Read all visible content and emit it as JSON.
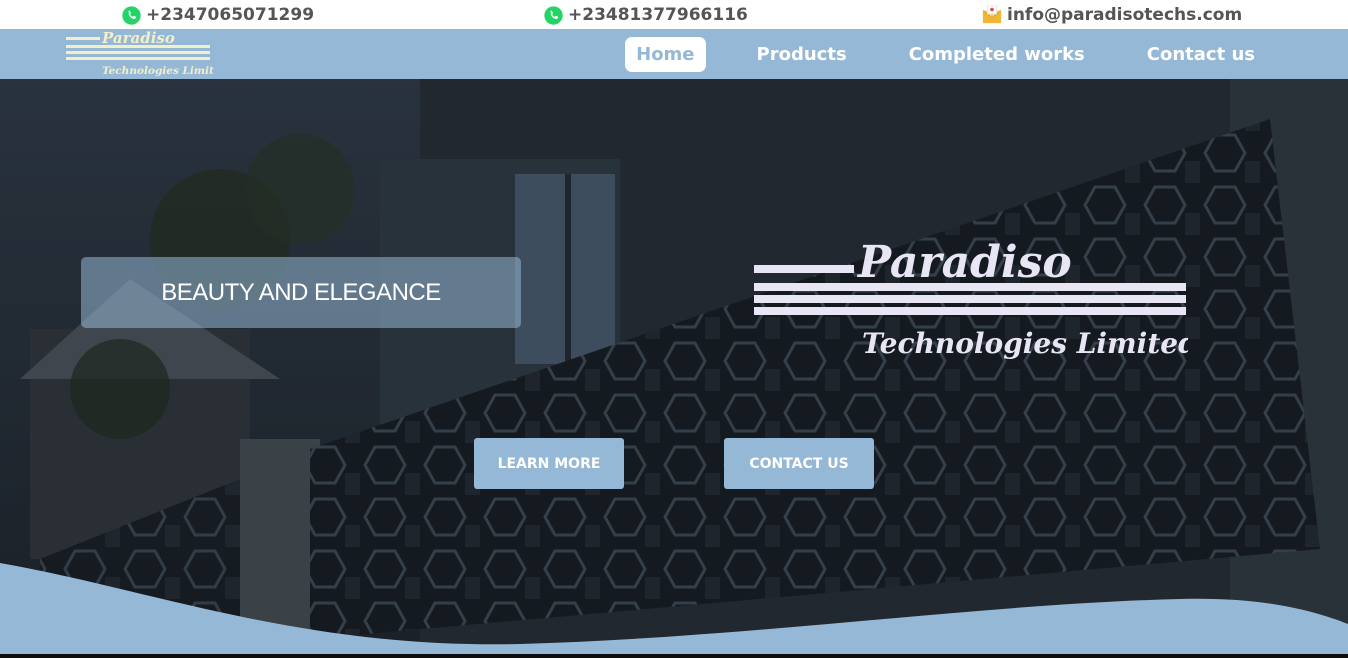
{
  "topbar": {
    "phone1": "+2347065071299",
    "phone2": "+23481377966116",
    "email": "info@paradisotechs.com",
    "icons": [
      "whatsapp-icon",
      "whatsapp-icon",
      "mail-icon"
    ]
  },
  "brand": {
    "name": "Paradiso",
    "subtitle": "Technologies Limited"
  },
  "nav": {
    "items": [
      {
        "label": "Home",
        "active": true
      },
      {
        "label": "Products",
        "active": false
      },
      {
        "label": "Completed works",
        "active": false
      },
      {
        "label": "Contact us",
        "active": false
      }
    ]
  },
  "hero": {
    "tagline": "BEAUTY AND ELEGANCE",
    "learn_more": "LEARN MORE",
    "contact_us": "CONTACT US"
  },
  "colors": {
    "accent": "#95b8d6",
    "logo_cream": "#f3efc9",
    "logo_white": "#e8e6f5",
    "whatsapp": "#25d366",
    "contact_text": "#555555"
  }
}
